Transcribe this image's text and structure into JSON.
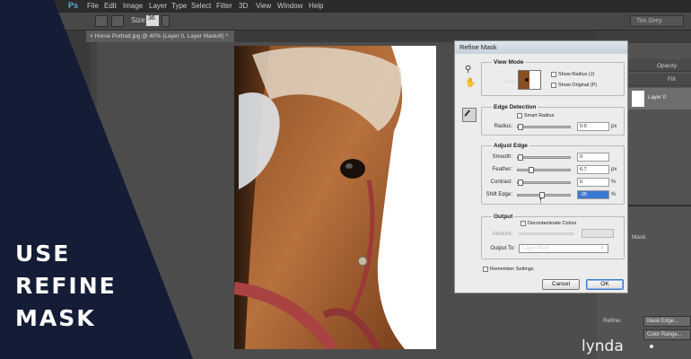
{
  "app": {
    "logo": "Ps",
    "menu": [
      "File",
      "Edit",
      "Image",
      "Layer",
      "Type",
      "Select",
      "Filter",
      "3D",
      "View",
      "Window",
      "Help"
    ],
    "workspace": "Tim Grey"
  },
  "options_bar": {
    "size_label": "Size:",
    "size_value": "36"
  },
  "document_tab": "× Horse Portrait.jpg @ 40% (Layer 0, Layer Mask/8) *",
  "panels": {
    "opacity_label": "Opacity:",
    "fill_label": "Fill:",
    "layer_name": "Layer 0",
    "mask_label": "Mask",
    "refine_label": "Refine:",
    "mask_edge_button": "Mask Edge...",
    "color_range_button": "Color Range..."
  },
  "dialog": {
    "title": "Refine Mask",
    "view_mode": {
      "title": "View Mode",
      "view_label": "View:",
      "show_radius": "Show Radius (J)",
      "show_original": "Show Original (P)"
    },
    "edge_detection": {
      "title": "Edge Detection",
      "smart_radius": "Smart Radius",
      "radius_label": "Radius:",
      "radius_value": "0.0",
      "radius_unit": "px"
    },
    "adjust_edge": {
      "title": "Adjust Edge",
      "smooth_label": "Smooth:",
      "smooth_value": "0",
      "feather_label": "Feather:",
      "feather_value": "6.7",
      "feather_unit": "px",
      "contrast_label": "Contrast:",
      "contrast_value": "0",
      "contrast_unit": "%",
      "shift_label": "Shift Edge:",
      "shift_value": "-35",
      "shift_unit": "%"
    },
    "output": {
      "title": "Output",
      "decontaminate": "Decontaminate Colors",
      "amount_label": "Amount:",
      "output_to_label": "Output To:",
      "output_to_value": "Layer Mask"
    },
    "remember": "Remember Settings",
    "cancel": "Cancel",
    "ok": "OK"
  },
  "overlay": {
    "line1": "USE",
    "line2": "REFINE",
    "line3": "MASK"
  },
  "watermark": "lynda",
  "colors": {
    "navy": "#141c36",
    "dialog": "#ececec",
    "highlight": "#3a7ad6"
  }
}
